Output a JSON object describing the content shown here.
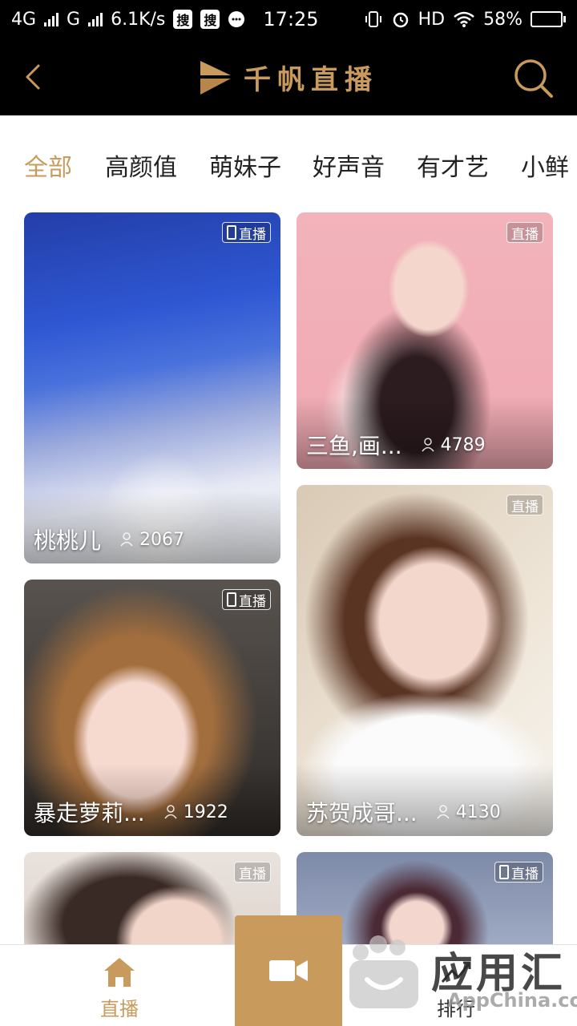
{
  "status_bar": {
    "network": "4G",
    "network2": "G",
    "speed": "6.1K/s",
    "sou1": "搜",
    "sou2": "搜",
    "time": "17:25",
    "hd": "HD",
    "battery": "58%",
    "battery_level": 0.58
  },
  "header": {
    "title": "千帆直播"
  },
  "categories": {
    "items": [
      "全部",
      "高颜值",
      "萌妹子",
      "好声音",
      "有才艺",
      "小鲜"
    ],
    "active_index": 0
  },
  "live_badge": "直播",
  "streams": [
    {
      "name": "桃桃儿",
      "viewers": "2067"
    },
    {
      "name": "三鱼,画...",
      "viewers": "4789"
    },
    {
      "name": "暴走萝莉...",
      "viewers": "1922"
    },
    {
      "name": "苏贺成哥...",
      "viewers": "4130"
    },
    {
      "name": "",
      "viewers": ""
    },
    {
      "name": "",
      "viewers": ""
    }
  ],
  "bottom_nav": {
    "live_label": "直播",
    "rank_label": "排行"
  },
  "watermark": {
    "text": "应用汇",
    "sub": "AppChina.com"
  },
  "colors": {
    "accent": "#c89a5c",
    "header_bg": "#000000"
  }
}
